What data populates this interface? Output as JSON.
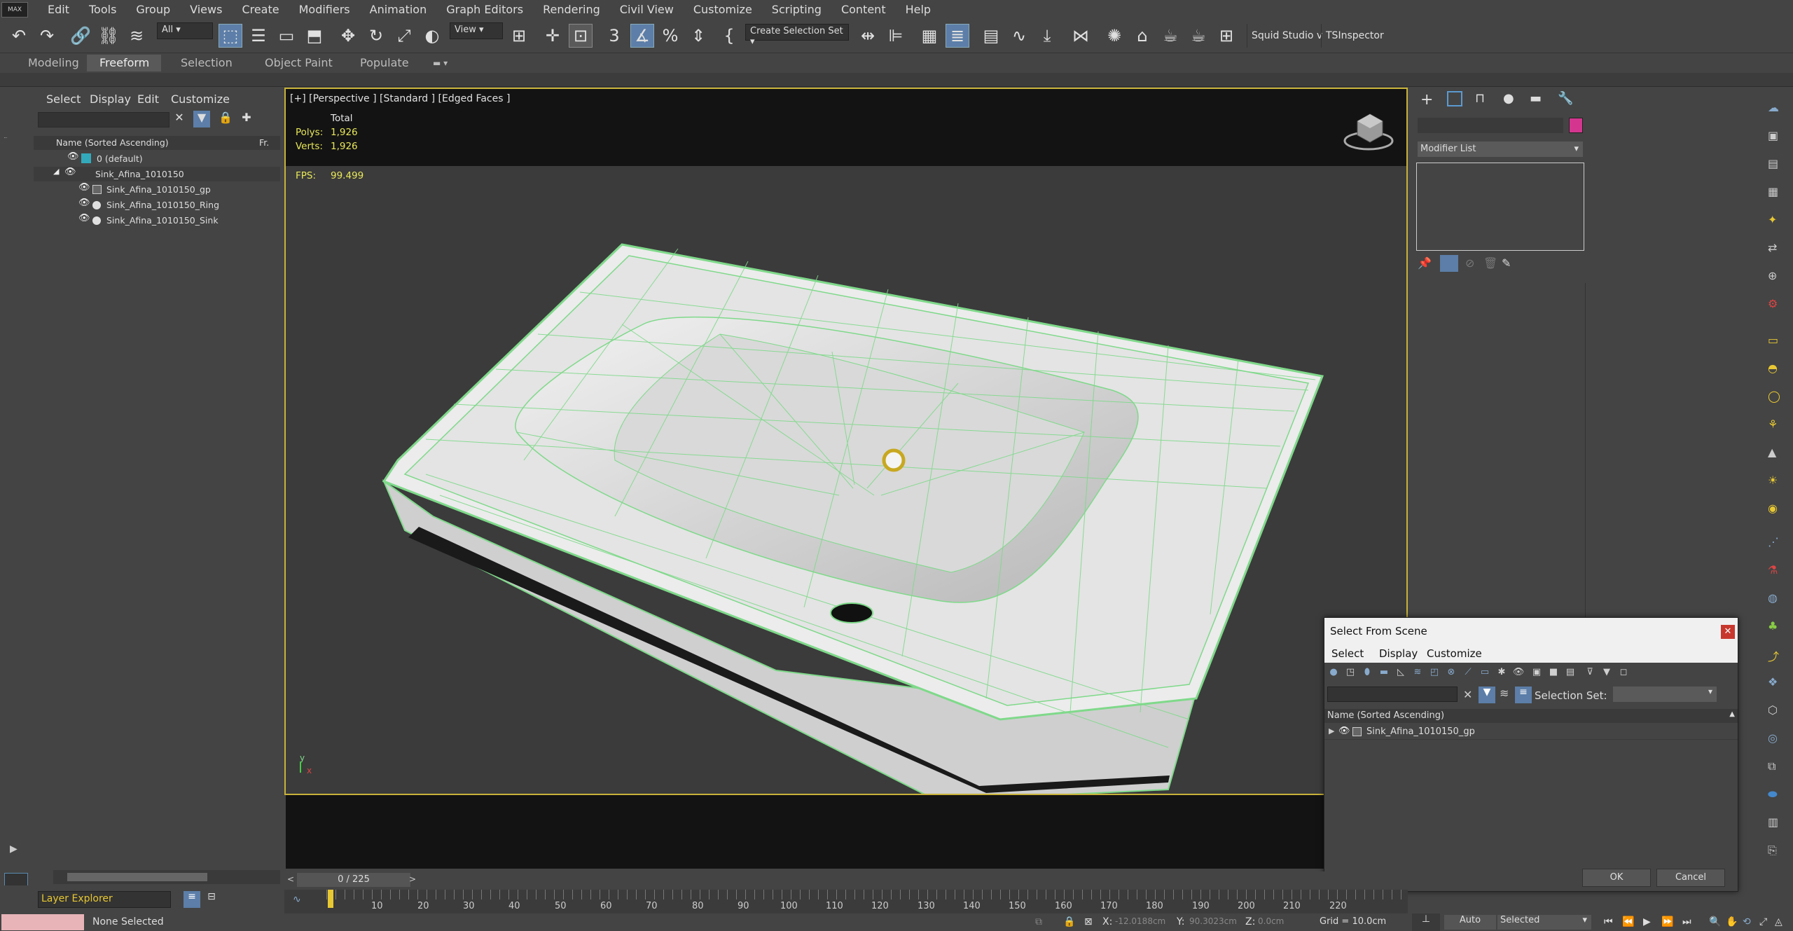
{
  "menubar": {
    "logo": "MAX",
    "items": [
      "Edit",
      "Tools",
      "Group",
      "Views",
      "Create",
      "Modifiers",
      "Animation",
      "Graph Editors",
      "Rendering",
      "Civil View",
      "Customize",
      "Scripting",
      "Content",
      "Help"
    ]
  },
  "toolbar": {
    "filter_select": "All",
    "view_select": "View",
    "selection_set": "Create Selection Set",
    "squid": "Squid Studio v",
    "tsinspector": "TSInspector",
    "angle_snap": "3"
  },
  "ribbon": {
    "tabs": [
      "Modeling",
      "Freeform",
      "Selection",
      "Object Paint",
      "Populate"
    ],
    "active_tab": "Freeform"
  },
  "scene_explorer": {
    "menu": [
      "Select",
      "Display",
      "Edit",
      "Customize"
    ],
    "header_name": "Name (Sorted Ascending)",
    "header_fr": "Fr.",
    "rows": [
      {
        "label": "0 (default)",
        "kind": "layer"
      },
      {
        "label": "Sink_Afina_1010150",
        "kind": "layer-open"
      },
      {
        "label": "Sink_Afina_1010150_gp",
        "kind": "group"
      },
      {
        "label": "Sink_Afina_1010150_Ring",
        "kind": "object"
      },
      {
        "label": "Sink_Afina_1010150_Sink",
        "kind": "object"
      }
    ],
    "footer": "Layer Explorer"
  },
  "viewport": {
    "label": "[+] [Perspective ] [Standard ] [Edged Faces ]",
    "stats_total": "Total",
    "polys_label": "Polys:",
    "polys_value": "1,926",
    "verts_label": "Verts:",
    "verts_value": "1,926",
    "fps_label": "FPS:",
    "fps_value": "99.499",
    "axis_y": "y",
    "axis_x": "x"
  },
  "command_panel": {
    "modifier_list": "Modifier List",
    "object_color": "#d4368f"
  },
  "dialog": {
    "title": "Select From Scene",
    "menu": [
      "Select",
      "Display",
      "Customize"
    ],
    "selection_set_label": "Selection Set:",
    "header": "Name (Sorted Ascending)",
    "rows": [
      "Sink_Afina_1010150_gp"
    ],
    "ok": "OK",
    "cancel": "Cancel"
  },
  "timeline": {
    "frame": "0 / 225",
    "ticks": [
      "10",
      "20",
      "30",
      "40",
      "50",
      "60",
      "70",
      "80",
      "90",
      "100",
      "110",
      "120",
      "130",
      "140",
      "150",
      "160",
      "170",
      "180",
      "190",
      "200",
      "210",
      "220"
    ]
  },
  "statusbar": {
    "selection": "None Selected",
    "x_label": "X:",
    "x_value": "-12.0188cm",
    "y_label": "Y:",
    "y_value": "90.3023cm",
    "z_label": "Z:",
    "z_value": "0.0cm",
    "grid": "Grid = 10.0cm",
    "auto": "Auto",
    "selected_select": "Selected"
  },
  "colors": {
    "accent": "#5c7ea8",
    "viewport_border": "#c8b23a",
    "wire": "#7fd98a",
    "stats": "#e8e85a",
    "close_red": "#c8372d"
  }
}
